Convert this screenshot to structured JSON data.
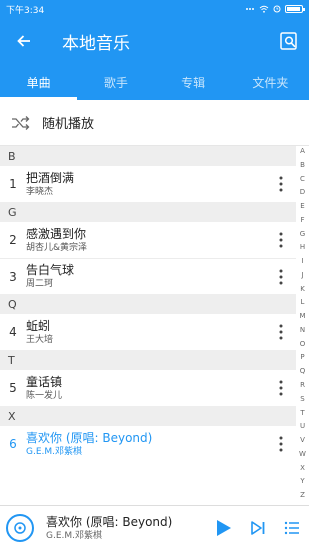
{
  "status_bar": {
    "time": "下午3:34",
    "battery_level": 0.8
  },
  "app_bar": {
    "title": "本地音乐"
  },
  "tabs": [
    {
      "label": "单曲",
      "active": true
    },
    {
      "label": "歌手",
      "active": false
    },
    {
      "label": "专辑",
      "active": false
    },
    {
      "label": "文件夹",
      "active": false
    }
  ],
  "shuffle": {
    "label": "随机播放"
  },
  "sections": [
    {
      "letter": "B",
      "songs": [
        {
          "num": "1",
          "title": "把酒倒满",
          "artist": "李晓杰"
        }
      ]
    },
    {
      "letter": "G",
      "songs": [
        {
          "num": "2",
          "title": "感激遇到你",
          "artist": "胡杏儿&黄宗泽"
        },
        {
          "num": "3",
          "title": "告白气球",
          "artist": "周二珂"
        }
      ]
    },
    {
      "letter": "Q",
      "songs": [
        {
          "num": "4",
          "title": "蚯蚓",
          "artist": "王大培"
        }
      ]
    },
    {
      "letter": "T",
      "songs": [
        {
          "num": "5",
          "title": "童话镇",
          "artist": "陈一发儿"
        }
      ]
    },
    {
      "letter": "X",
      "songs": [
        {
          "num": "6",
          "title": "喜欢你 (原唱: Beyond)",
          "artist": "G.E.M.邓紫棋",
          "playing": true
        }
      ]
    }
  ],
  "alpha_index": [
    "A",
    "B",
    "C",
    "D",
    "E",
    "F",
    "G",
    "H",
    "I",
    "J",
    "K",
    "L",
    "M",
    "N",
    "O",
    "P",
    "Q",
    "R",
    "S",
    "T",
    "U",
    "V",
    "W",
    "X",
    "Y",
    "Z",
    "#"
  ],
  "now_playing": {
    "title": "喜欢你 (原唱: Beyond)",
    "artist": "G.E.M.邓紫棋"
  },
  "colors": {
    "accent": "#2196f3",
    "section_bg": "#eeeeee"
  },
  "icons": {
    "back": "arrow-left-icon",
    "search": "search-icon",
    "shuffle": "shuffle-icon",
    "more": "more-vertical-icon",
    "disc": "disc-icon",
    "play": "play-icon",
    "next": "skip-next-icon",
    "playlist": "playlist-icon"
  }
}
